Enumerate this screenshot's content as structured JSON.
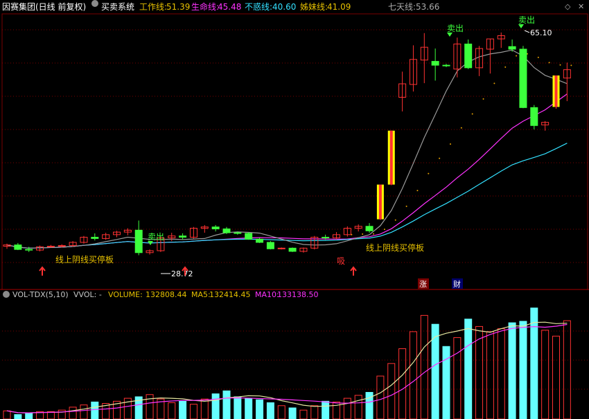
{
  "header": {
    "stock_title": "因赛集团(日线 前复权)",
    "system_name": "买卖系统",
    "indicators": [
      {
        "label": "工作线:",
        "value": "51.39",
        "color": "#e6c000"
      },
      {
        "label": "生命线:",
        "value": "45.48",
        "color": "#ff33ff"
      },
      {
        "label": "不惑线:",
        "value": "40.60",
        "color": "#33e0ff"
      },
      {
        "label": "姊妹线:",
        "value": "41.09",
        "color": "#e6c000"
      }
    ],
    "seven_day": {
      "label": "七天线:",
      "value": "53.66",
      "color": "#aaaaaa"
    }
  },
  "volume": {
    "name": "VOL-TDX(5,10)",
    "vvol": "VVOL: -",
    "volume_label": "VOLUME:",
    "volume_value": "132808.44",
    "ma5_label": "MA5:",
    "ma5_value": "132414.45",
    "ma10_label": "MA10:",
    "ma10_value": "133138.50"
  },
  "annotations": {
    "sell_1": "卖出",
    "sell_2": "卖出",
    "sell_3": "卖出",
    "buy": "吸",
    "text_1": "线上阴线买停板",
    "text_2": "线上阴线买停板",
    "high_label": "65.10",
    "low_label": "28.72",
    "tag_zhang": "涨",
    "tag_cai": "财"
  },
  "colors": {
    "up": "#ff3232",
    "down": "#3cff3c",
    "bg": "#000000",
    "yellow": "#ffff00",
    "grid": "#7a0000"
  },
  "chart_data": {
    "type": "candlestick",
    "candles": [
      [
        31.8,
        32.2,
        31.4,
        32.0
      ],
      [
        32.0,
        32.3,
        31.2,
        31.3
      ],
      [
        31.3,
        31.7,
        30.9,
        31.2
      ],
      [
        31.2,
        31.9,
        31.0,
        31.7
      ],
      [
        31.7,
        32.0,
        31.6,
        31.8
      ],
      [
        31.8,
        32.1,
        31.6,
        31.9
      ],
      [
        31.9,
        32.6,
        31.7,
        32.4
      ],
      [
        32.4,
        33.4,
        32.2,
        33.2
      ],
      [
        33.2,
        33.8,
        32.7,
        33.0
      ],
      [
        33.0,
        33.9,
        32.8,
        33.6
      ],
      [
        33.6,
        34.2,
        33.2,
        34.0
      ],
      [
        34.0,
        34.6,
        33.5,
        34.3
      ],
      [
        34.3,
        35.8,
        30.4,
        30.8
      ],
      [
        30.8,
        31.3,
        30.5,
        31.1
      ],
      [
        31.1,
        33.3,
        30.9,
        33.1
      ],
      [
        33.1,
        33.9,
        32.6,
        33.4
      ],
      [
        33.4,
        33.8,
        32.8,
        33.2
      ],
      [
        33.2,
        34.8,
        33.0,
        34.6
      ],
      [
        34.6,
        35.1,
        33.9,
        34.8
      ],
      [
        34.8,
        35.1,
        34.1,
        34.5
      ],
      [
        34.5,
        34.8,
        33.7,
        33.9
      ],
      [
        33.9,
        34.1,
        33.6,
        33.8
      ],
      [
        33.8,
        34.0,
        32.8,
        32.9
      ],
      [
        32.9,
        33.1,
        32.3,
        32.4
      ],
      [
        32.4,
        32.6,
        31.3,
        31.4
      ],
      [
        31.4,
        31.6,
        31.3,
        31.5
      ],
      [
        31.5,
        31.6,
        30.9,
        31.0
      ],
      [
        31.0,
        31.6,
        30.8,
        31.5
      ],
      [
        31.5,
        33.4,
        31.3,
        33.2
      ],
      [
        33.2,
        33.6,
        32.8,
        33.1
      ],
      [
        33.1,
        34.0,
        32.9,
        33.6
      ],
      [
        33.6,
        34.9,
        33.3,
        34.6
      ],
      [
        34.6,
        35.2,
        34.1,
        34.9
      ],
      [
        34.9,
        35.4,
        33.9,
        34.2
      ],
      [
        36.0,
        41.4,
        35.9,
        41.4
      ],
      [
        41.4,
        49.8,
        41.3,
        49.8
      ],
      [
        55.0,
        59.0,
        52.8,
        57.1
      ],
      [
        57.0,
        63.1,
        55.9,
        60.9
      ],
      [
        60.8,
        65.0,
        57.2,
        62.8
      ],
      [
        60.6,
        62.6,
        57.6,
        60.0
      ],
      [
        60.0,
        60.2,
        59.7,
        59.9
      ],
      [
        59.4,
        64.3,
        58.1,
        63.3
      ],
      [
        63.3,
        64.0,
        59.4,
        59.6
      ],
      [
        59.6,
        63.0,
        58.3,
        62.6
      ],
      [
        62.5,
        64.1,
        58.7,
        64.1
      ],
      [
        64.1,
        65.1,
        62.7,
        64.6
      ],
      [
        62.9,
        64.0,
        62.1,
        62.5
      ],
      [
        62.5,
        63.0,
        53.3,
        53.4
      ],
      [
        53.4,
        53.8,
        50.0,
        50.6
      ],
      [
        50.7,
        51.3,
        49.8,
        51.1
      ],
      [
        53.5,
        58.4,
        53.2,
        58.4
      ],
      [
        58.0,
        60.4,
        54.4,
        59.3
      ]
    ],
    "volumes": [
      11000,
      6000,
      8000,
      10000,
      10000,
      12000,
      16000,
      19000,
      23000,
      21000,
      24000,
      28000,
      30000,
      33000,
      27000,
      22000,
      24000,
      20000,
      27000,
      34000,
      38000,
      30000,
      28000,
      26000,
      22000,
      18000,
      15000,
      12000,
      18000,
      24000,
      23000,
      28000,
      32000,
      36000,
      58000,
      75000,
      95000,
      118000,
      140000,
      128000,
      98000,
      110000,
      135000,
      125000,
      118000,
      122000,
      130000,
      132000,
      150000,
      120000,
      112000,
      132808.44
    ],
    "ylim_price": [
      27.0,
      68.0
    ],
    "ylim_volume": [
      0,
      160000
    ]
  }
}
